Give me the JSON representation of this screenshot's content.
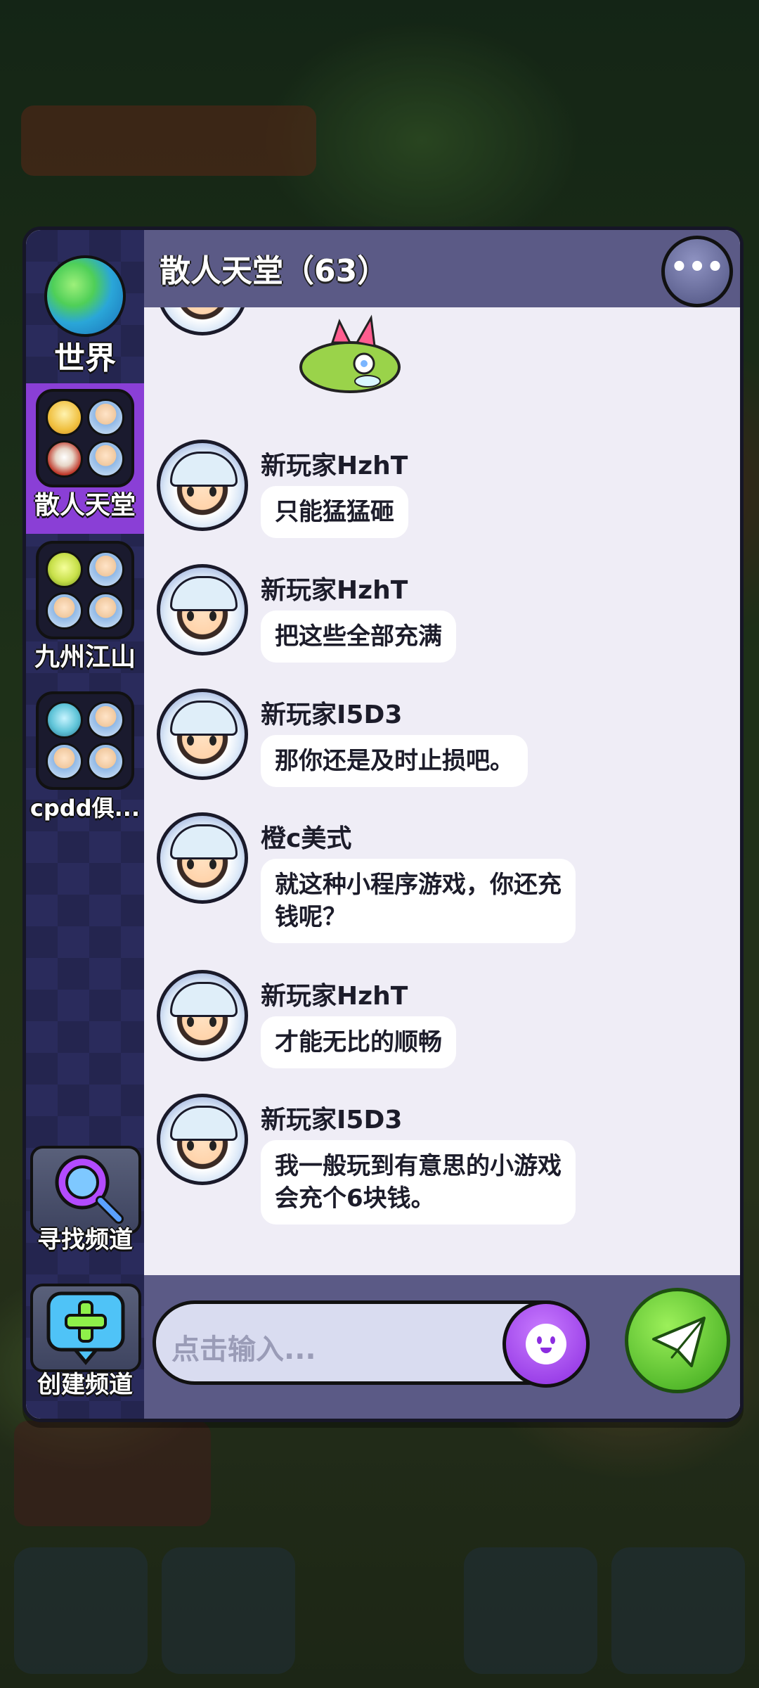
{
  "sidebar": {
    "channels": [
      {
        "label": "世界"
      },
      {
        "label": "散人天堂"
      },
      {
        "label": "九州江山"
      },
      {
        "label": "cpdd俱..."
      }
    ],
    "find_channel": "寻找频道",
    "create_channel": "创建频道"
  },
  "header": {
    "title": "散人天堂（63）"
  },
  "messages": [
    {
      "name": "新玩家HzhT",
      "text": "只能猛猛砸"
    },
    {
      "name": "新玩家HzhT",
      "text": "把这些全部充满"
    },
    {
      "name": "新玩家I5D3",
      "text": "那你还是及时止损吧。"
    },
    {
      "name": "橙c美式",
      "text": "就这种小程序游戏，你还充\n钱呢？"
    },
    {
      "name": "新玩家HzhT",
      "text": "才能无比的顺畅"
    },
    {
      "name": "新玩家I5D3",
      "text": "我一般玩到有意思的小游戏\n会充个6块钱。"
    }
  ],
  "input": {
    "placeholder": "点击输入..."
  },
  "icons": {
    "more": "more-icon",
    "emoji": "emoji-icon",
    "send": "send-icon",
    "find": "magnifier-icon",
    "create": "plus-chat-icon"
  },
  "colors": {
    "header": "#5b5a86",
    "selected": "#8a3fd6",
    "send": "#3aa51b",
    "emoji": "#8b2ce0"
  }
}
